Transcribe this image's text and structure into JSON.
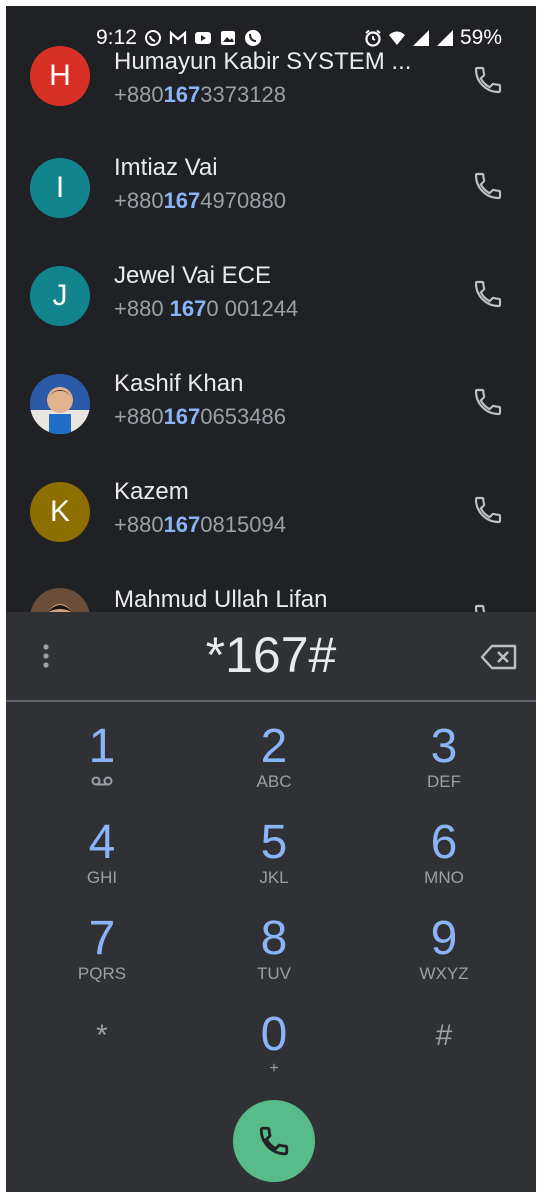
{
  "status_bar": {
    "time": "9:12",
    "battery": "59%",
    "icons_left": [
      "whatsapp-icon",
      "gmail-icon",
      "youtube-icon",
      "gallery-icon",
      "viber-icon"
    ],
    "icons_right": [
      "alarm-icon",
      "wifi-icon",
      "signal-icon",
      "signal-icon"
    ]
  },
  "contacts": [
    {
      "initial": "H",
      "avatar_color": "#d93025",
      "name": "Humayun Kabir SYSTEM ...",
      "number_pre": "+880",
      "number_hl": "167",
      "number_post": "3373128"
    },
    {
      "initial": "I",
      "avatar_color": "#12848d",
      "name": "Imtiaz Vai",
      "number_pre": "+880",
      "number_hl": "167",
      "number_post": "4970880"
    },
    {
      "initial": "J",
      "avatar_color": "#12848d",
      "name": "Jewel Vai ECE",
      "number_pre": "+880 ",
      "number_hl": "167",
      "number_post": "0 001244"
    },
    {
      "initial": "",
      "avatar_color": "#3d6fb8",
      "name": "Kashif Khan",
      "number_pre": "+880",
      "number_hl": "167",
      "number_post": "0653486"
    },
    {
      "initial": "K",
      "avatar_color": "#8d6e00",
      "name": "Kazem",
      "number_pre": "+880",
      "number_hl": "167",
      "number_post": "0815094"
    },
    {
      "initial": "",
      "avatar_color": "#6b4e3a",
      "name": "Mahmud Ullah Lifan",
      "number_pre": "",
      "number_hl": "",
      "number_post": ""
    }
  ],
  "dialer": {
    "dialed_text": "*167#",
    "keys": [
      {
        "digit": "1",
        "letters": ""
      },
      {
        "digit": "2",
        "letters": "ABC"
      },
      {
        "digit": "3",
        "letters": "DEF"
      },
      {
        "digit": "4",
        "letters": "GHI"
      },
      {
        "digit": "5",
        "letters": "JKL"
      },
      {
        "digit": "6",
        "letters": "MNO"
      },
      {
        "digit": "7",
        "letters": "PQRS"
      },
      {
        "digit": "8",
        "letters": "TUV"
      },
      {
        "digit": "9",
        "letters": "WXYZ"
      },
      {
        "digit": "*",
        "letters": ""
      },
      {
        "digit": "0",
        "letters": "+"
      },
      {
        "digit": "#",
        "letters": ""
      }
    ]
  },
  "colors": {
    "background": "#202124",
    "dialpad": "#303134",
    "accent": "#8ab4f8",
    "call_button": "#57bb8a"
  }
}
